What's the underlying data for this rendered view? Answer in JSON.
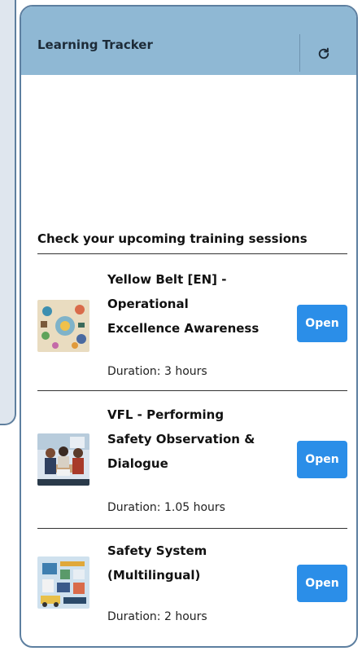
{
  "header": {
    "title": "Learning Tracker",
    "refresh_icon": "refresh-icon"
  },
  "section": {
    "heading": "Check your upcoming training sessions"
  },
  "courses": [
    {
      "title_lines": [
        "Yellow Belt [EN] -",
        "Operational",
        "Excellence Awareness"
      ],
      "duration": "Duration: 3 hours",
      "button": "Open"
    },
    {
      "title_lines": [
        "VFL - Performing",
        "Safety Observation &",
        "Dialogue"
      ],
      "duration": "Duration: 1.05 hours",
      "button": "Open"
    },
    {
      "title_lines": [
        "Safety System",
        "(Multilingual)"
      ],
      "duration": "Duration: 2 hours",
      "button": "Open"
    }
  ],
  "colors": {
    "header_bg": "#8fb8d4",
    "button_bg": "#2b8ee8",
    "border": "#5d7fa0"
  }
}
